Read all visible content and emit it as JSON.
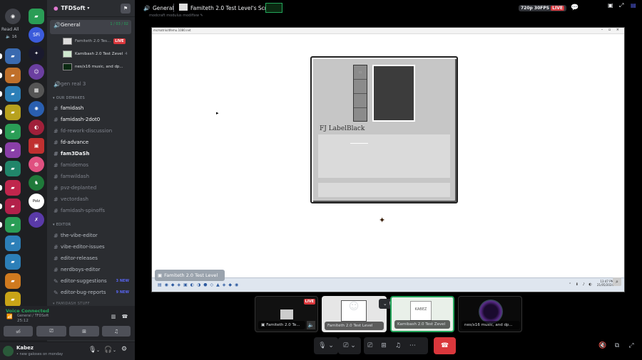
{
  "server": {
    "name": "TFDSoft",
    "read_all": "Read All",
    "read_count": "16"
  },
  "colors": {
    "accent": "#5865f2",
    "live": "#da373c",
    "green": "#23a55a",
    "bg": "#2b2d31",
    "rail": "#1e1f22"
  },
  "voice_channel": {
    "name": "General",
    "count": "1 / 03 / 02"
  },
  "streams_in_sidebar": [
    {
      "label": "Famiteth 2.0 Tes...",
      "badge": "LIVE"
    },
    {
      "label": "Kamibash 2.0 Test Zevel",
      "badge": "4"
    },
    {
      "label": "nes/x16 music, and dp...",
      "badge": ""
    }
  ],
  "gen_real": "gen real 3",
  "cat_remakes": "OUR DEMAKES",
  "remake_channels": [
    {
      "name": "famidash",
      "state": "bright"
    },
    {
      "name": "famidash-2dot0",
      "state": "bright"
    },
    {
      "name": "fd-rework-discussion",
      "state": "muted"
    },
    {
      "name": "fd-advance",
      "state": "bright"
    },
    {
      "name": "fam3DaSh",
      "state": "bright"
    },
    {
      "name": "famidemos",
      "state": "muted"
    },
    {
      "name": "famwildash",
      "state": "muted"
    },
    {
      "name": "pvz-deplanted",
      "state": "muted"
    },
    {
      "name": "vectordash",
      "state": "muted"
    },
    {
      "name": "famidash-spinoffs",
      "state": "muted"
    }
  ],
  "cat_editor": "EDITOR",
  "editor_channels": [
    {
      "name": "the-vibe-editor",
      "badge": ""
    },
    {
      "name": "vibe-editor-issues",
      "badge": ""
    },
    {
      "name": "editor-releases",
      "badge": ""
    },
    {
      "name": "nerdboys-editor",
      "badge": ""
    },
    {
      "name": "editor-suggestions",
      "badge": "3 NEW"
    },
    {
      "name": "editor-bug-reports",
      "badge": "9 NEW"
    }
  ],
  "cat_famidash_stuff": "FAMIDASH STUFF",
  "voice_status": {
    "title": "Voice Connected",
    "where": "General / TFDSoft",
    "time": "25:12"
  },
  "user": {
    "name": "Kabez",
    "status": "• new galoses on monday"
  },
  "header": {
    "channel": "General",
    "stream_title": "Famiteth 2.0 Test Level's Screen",
    "sub": "modcraft modulus modifixw",
    "quality": "720p 30FPS",
    "live": "LIVE"
  },
  "shared": {
    "window_title": "mcmatrix/dfemu.1080.net",
    "gui_label": "FJ  LabelBlack",
    "taskbar_app": "Famiteth 2.0 Test Level",
    "clock_time": "13:47 PM",
    "clock_date": "21/05/2024"
  },
  "tiles": [
    {
      "label": "Famiteth 2.0 Te...",
      "badge": "LIVE"
    },
    {
      "label": "Famiteth 2.0 Test Level",
      "badge": ""
    },
    {
      "label": "Kamibash 2.0 Test Zevel",
      "badge": ""
    },
    {
      "label": "nes/x16 music, and dp...",
      "badge": ""
    }
  ],
  "icons": [
    "discord-icon",
    "speaker-icon",
    "hash-icon",
    "mic-icon",
    "headphones-icon",
    "gear-icon",
    "camera-icon",
    "screen-share-icon",
    "activity-icon",
    "leave-call-icon",
    "chat-icon",
    "expand-icon",
    "popout-icon"
  ]
}
